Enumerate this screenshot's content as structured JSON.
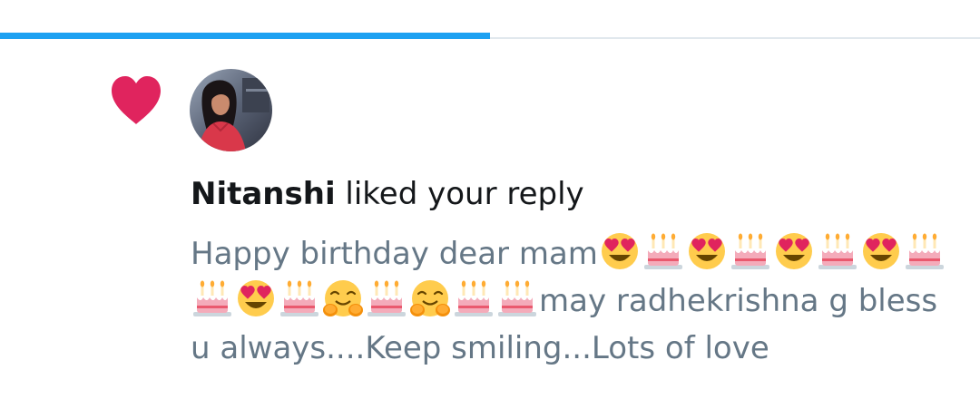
{
  "colors": {
    "accent": "#1da1f2",
    "like": "#e0245e",
    "primary_text": "#14171a",
    "secondary_text": "#657786",
    "divider": "#e1e8ed"
  },
  "progress": {
    "fraction": 0.5
  },
  "notification": {
    "icon": "heart-icon",
    "avatar_icon": "avatar",
    "user_name": "Nitanshi",
    "action_text": " liked your reply"
  },
  "reply": {
    "segments": [
      {
        "type": "text",
        "value": "Happy birthday dear mam"
      },
      {
        "type": "emoji",
        "name": "heart-eyes-emoji"
      },
      {
        "type": "emoji",
        "name": "birthday-cake-emoji"
      },
      {
        "type": "emoji",
        "name": "heart-eyes-emoji"
      },
      {
        "type": "emoji",
        "name": "birthday-cake-emoji"
      },
      {
        "type": "emoji",
        "name": "heart-eyes-emoji"
      },
      {
        "type": "emoji",
        "name": "birthday-cake-emoji"
      },
      {
        "type": "emoji",
        "name": "heart-eyes-emoji"
      },
      {
        "type": "emoji",
        "name": "birthday-cake-emoji"
      },
      {
        "type": "emoji",
        "name": "birthday-cake-emoji"
      },
      {
        "type": "emoji",
        "name": "heart-eyes-emoji"
      },
      {
        "type": "emoji",
        "name": "birthday-cake-emoji"
      },
      {
        "type": "emoji",
        "name": "hugging-face-emoji"
      },
      {
        "type": "emoji",
        "name": "birthday-cake-emoji"
      },
      {
        "type": "emoji",
        "name": "hugging-face-emoji"
      },
      {
        "type": "emoji",
        "name": "birthday-cake-emoji"
      },
      {
        "type": "emoji",
        "name": "birthday-cake-emoji"
      },
      {
        "type": "text",
        "value": "may radhekrishna g bless u always....Keep smiling...Lots of love"
      }
    ]
  }
}
